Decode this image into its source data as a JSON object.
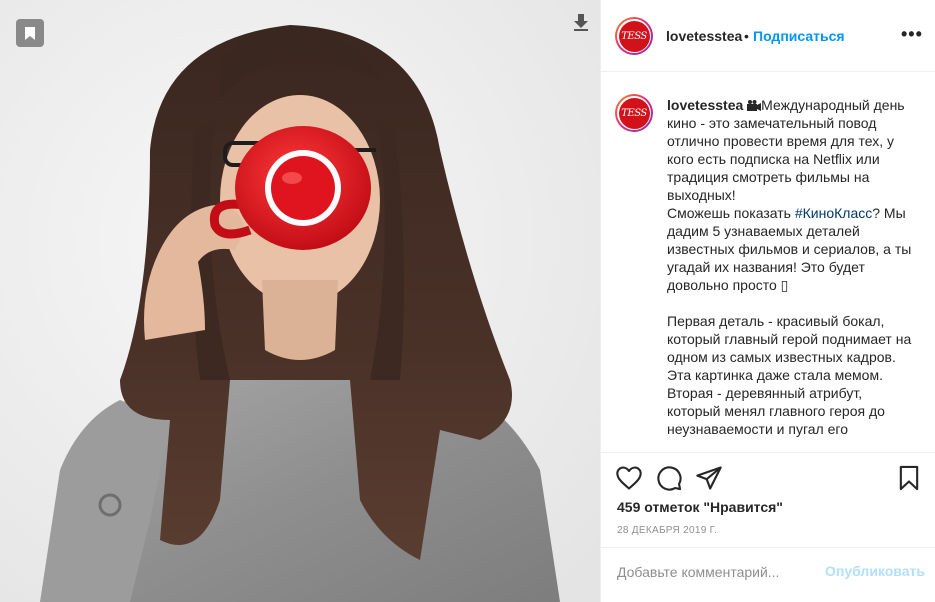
{
  "post": {
    "username": "lovetesstea",
    "avatar_text": "TESS",
    "header_separator": "•",
    "follow_label": "Подписаться",
    "more_label": "•••",
    "caption": {
      "username": "lovetesstea",
      "emoji_icon": "movie-camera-icon",
      "para1": "Международный день кино - это замечательный повод отлично провести время для тех, у кого есть подписка на Netflix или традиция смотреть фильмы на выходных!",
      "line_before_tag": "Сможешь показать ",
      "hashtag": "#КиноКласс",
      "line_after_tag": "? Мы дадим 5 узнаваемых деталей известных фильмов и сериалов, а ты угадай их названия! Это будет довольно просто ",
      "trailing_glyph": "▯",
      "para2": "Первая деталь - красивый бокал, который главный герой поднимает на одном из самых известных кадров. Эта картинка даже стала мемом.",
      "para3": "Вторая - деревянный атрибут, который менял главного героя до неузнаваемости и пугал его"
    },
    "likes_text": "459 отметок \"Нравится\"",
    "date_text": "28 декабря 2019 г.",
    "comment_placeholder": "Добавьте комментарий...",
    "publish_label": "Опубликовать"
  },
  "icons": {
    "like": "heart-icon",
    "comment": "comment-icon",
    "share": "paper-plane-icon",
    "save": "bookmark-icon",
    "photo_save": "bookmark-icon",
    "photo_download": "download-arrow-icon"
  },
  "colors": {
    "accent_blue": "#0095f6",
    "hashtag": "#00376b",
    "muted": "#8e8e8e",
    "publish_disabled": "#b2dffc",
    "brand_red": "#d3111b",
    "mug_red": "#e0141f"
  }
}
